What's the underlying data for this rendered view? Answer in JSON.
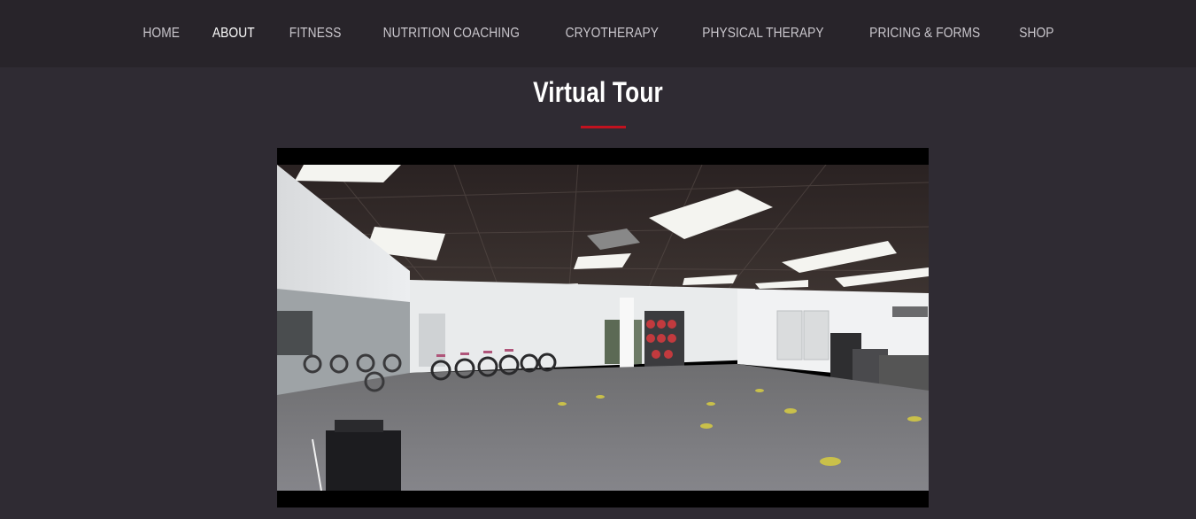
{
  "nav": {
    "items": [
      {
        "label": "HOME",
        "active": false
      },
      {
        "label": "ABOUT",
        "active": true
      },
      {
        "label": "FITNESS",
        "active": false
      },
      {
        "label": "NUTRITION COACHING",
        "active": false
      },
      {
        "label": "CRYOTHERAPY",
        "active": false
      },
      {
        "label": "PHYSICAL THERAPY",
        "active": false
      },
      {
        "label": "PRICING & FORMS",
        "active": false
      },
      {
        "label": "SHOP",
        "active": false
      }
    ]
  },
  "section": {
    "title": "Virtual Tour",
    "accent_color": "#c1121f"
  },
  "media": {
    "type": "virtual-tour-video",
    "subject": "gym-interior-panorama-icon"
  }
}
